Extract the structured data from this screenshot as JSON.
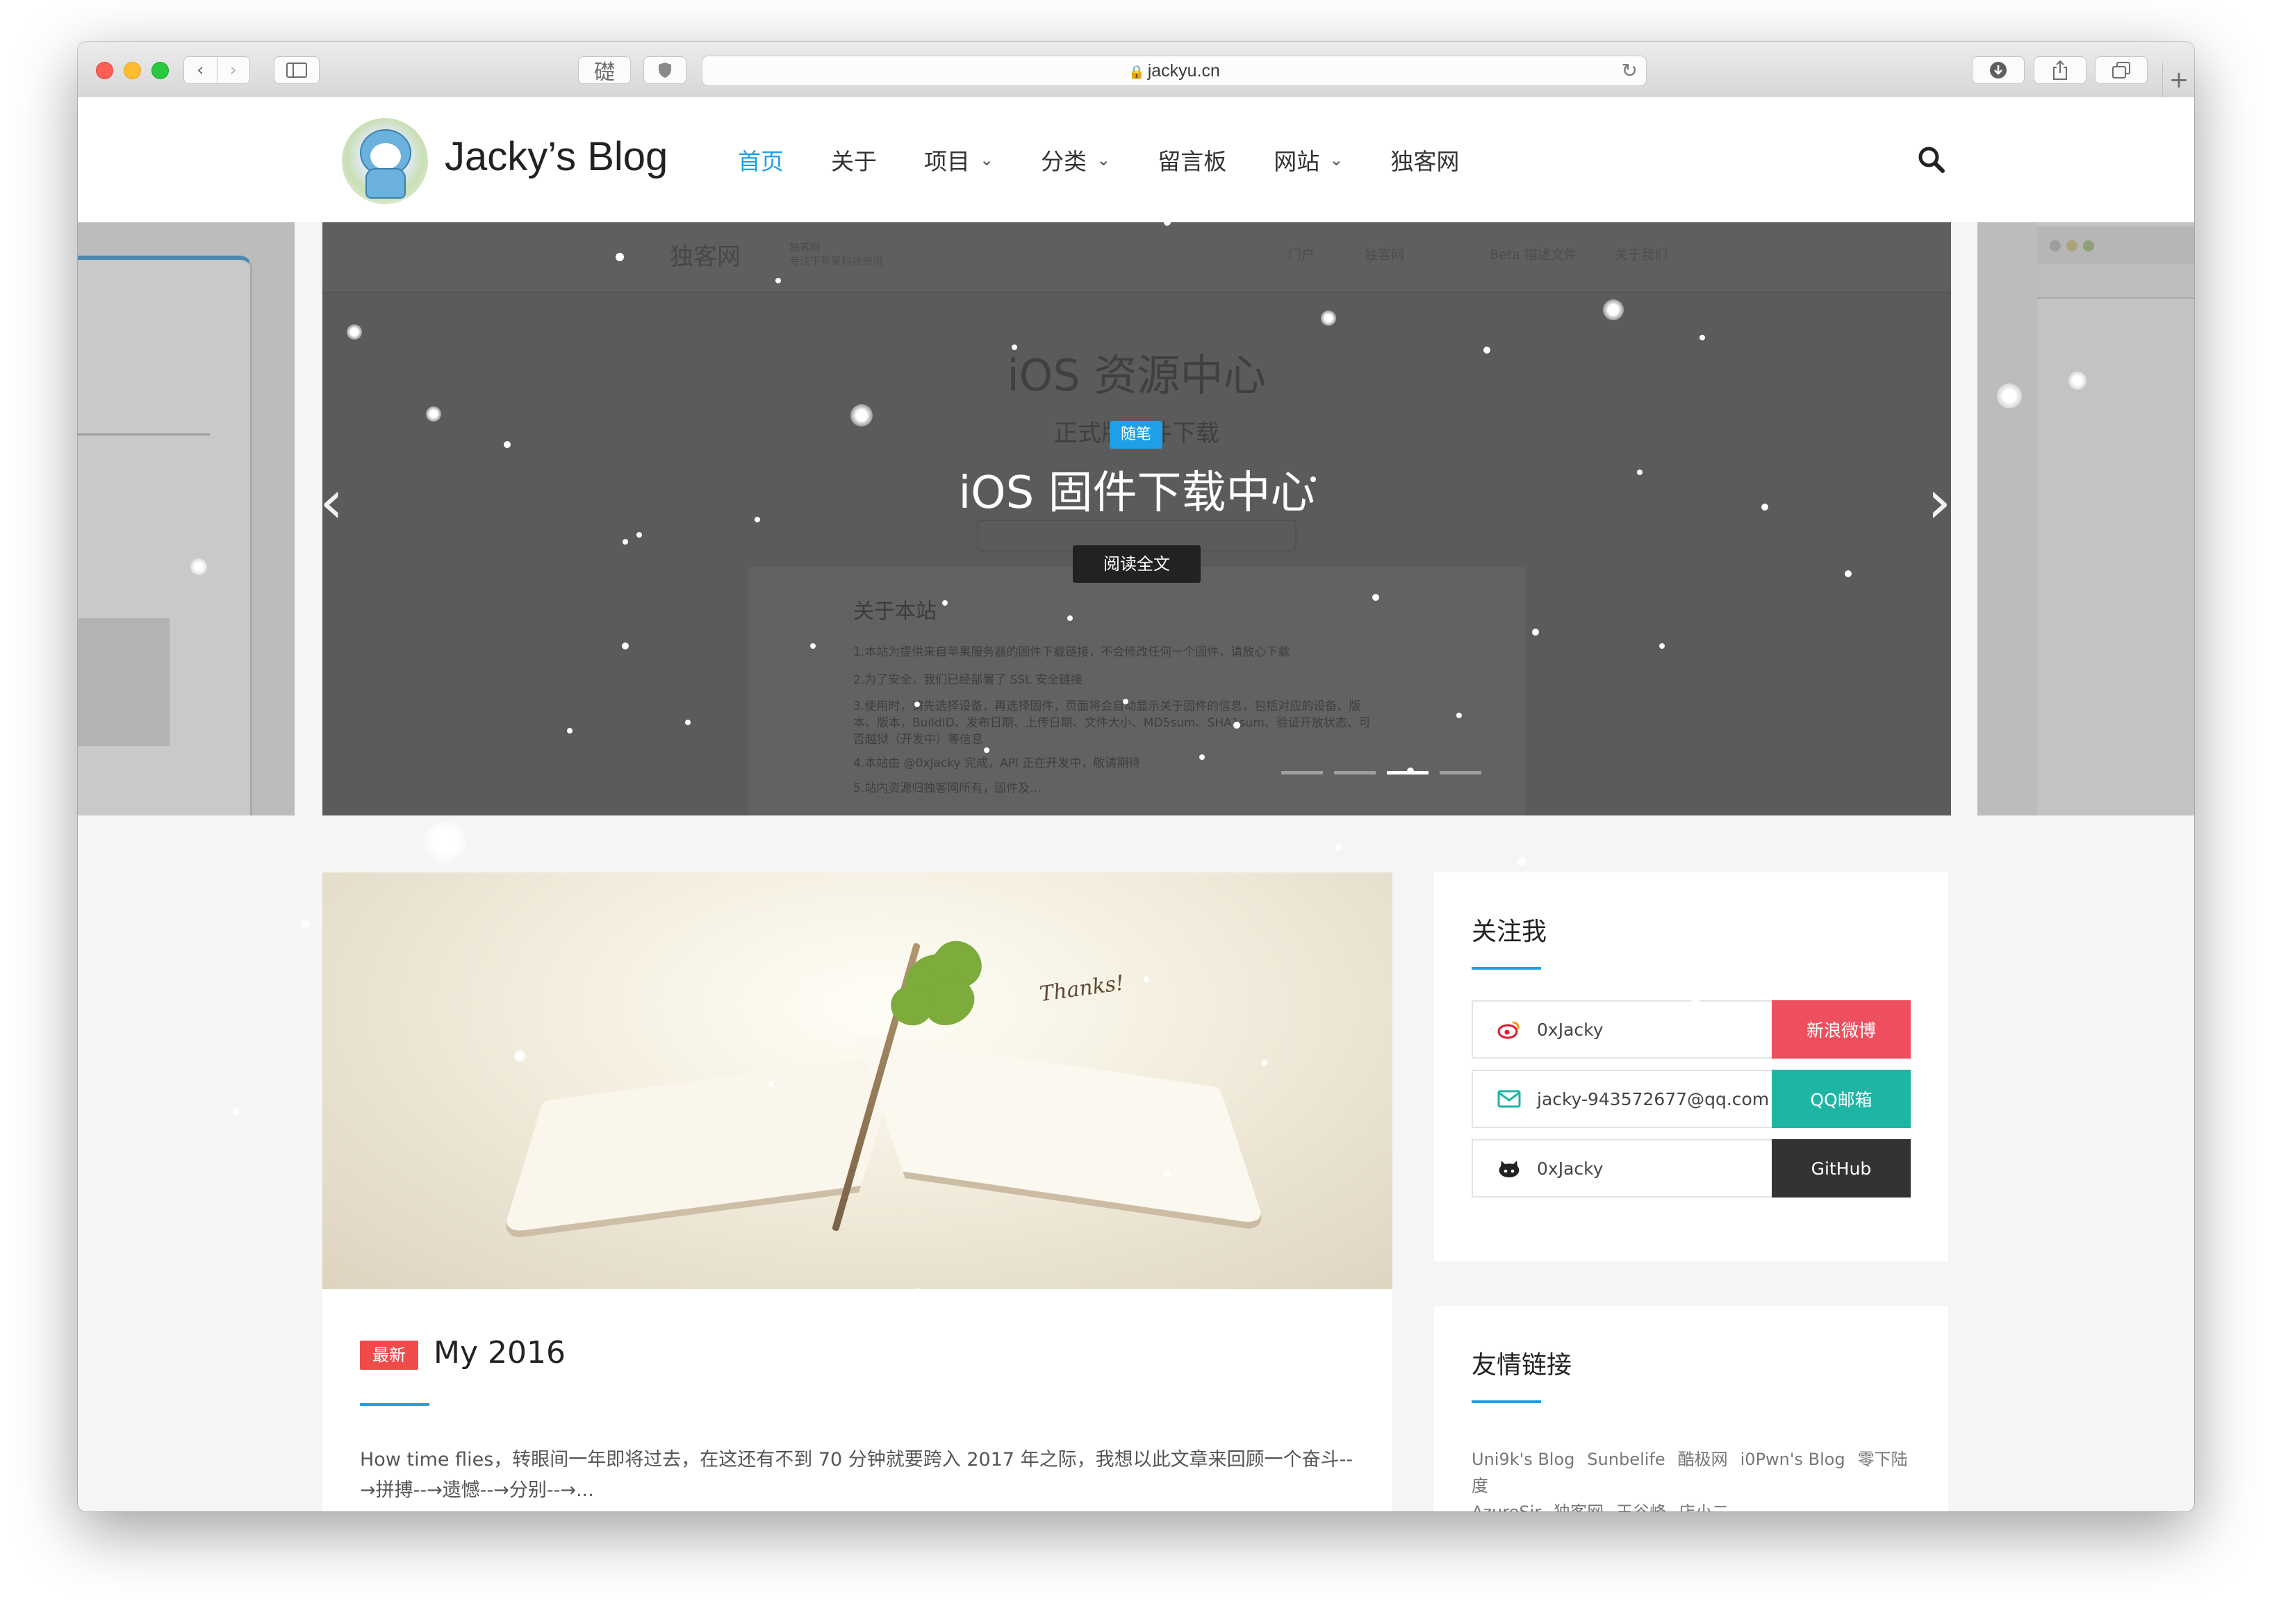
{
  "browser": {
    "url": "jackyu.cn",
    "reader_glyph": "礎"
  },
  "site": {
    "title": "Jacky’s Blog"
  },
  "nav": {
    "items": [
      {
        "label": "首页",
        "active": true,
        "dropdown": false
      },
      {
        "label": "关于",
        "active": false,
        "dropdown": false
      },
      {
        "label": "项目",
        "active": false,
        "dropdown": true
      },
      {
        "label": "分类",
        "active": false,
        "dropdown": true
      },
      {
        "label": "留言板",
        "active": false,
        "dropdown": false
      },
      {
        "label": "网站",
        "active": false,
        "dropdown": true
      },
      {
        "label": "独客网",
        "active": false,
        "dropdown": false
      }
    ]
  },
  "slider": {
    "background": {
      "logo": "独客网",
      "logo_sub_1": "独客网",
      "logo_sub_2": "专注于苹果科技资讯",
      "nav": [
        "门户",
        "独客网",
        "Beta 描述文件",
        "关于我们"
      ],
      "title": "iOS 资源中心",
      "subtitle": "正式版固件下载",
      "section_title": "关于本站",
      "lines": [
        "1.本站为提供来自苹果服务器的固件下载链接，不会修改任何一个固件，请放心下载",
        "2.为了安全，我们已经部署了 SSL 安全链接",
        "3.使用时，请先选择设备，再选择固件，页面将会自动显示关于固件的信息，包括对应的设备、版",
        "本、版本，BuildID、发布日期、上传日期、文件大小、MD5sum、SHA1sum、验证开放状态、可",
        "否越狱（开发中）等信息",
        "4.本站由 @0xJacky 完成，API 正在开发中，敬请期待",
        "5.站内资源归独客网所有，固件及..."
      ]
    },
    "category_tag": "随笔",
    "title": "iOS 固件下载中心",
    "read_more": "阅读全文",
    "active_dot": 3,
    "dot_count": 4
  },
  "post": {
    "badge": "最新",
    "title": "My 2016",
    "image_caption": "Thanks!",
    "excerpt": "How time flies，转眼间一年即将过去，在这还有不到 70 分钟就要跨入 2017 年之际，我想以此文章来回顾一个奋斗--→拼搏--→遗憾--→分别--→..."
  },
  "sidebar": {
    "follow_title": "关注我",
    "social": [
      {
        "icon": "weibo-icon",
        "value": "0xJacky",
        "button": "新浪微博",
        "color": "#ee4f5e"
      },
      {
        "icon": "mail-icon",
        "value": "jacky-943572677@qq.com",
        "button": "QQ邮箱",
        "color": "#1fb5a4"
      },
      {
        "icon": "github-icon",
        "value": "0xJacky",
        "button": "GitHub",
        "color": "#333333"
      }
    ],
    "links_title": "友情链接",
    "links": [
      "Uni9k's Blog",
      "Sunbelife",
      "酷极网",
      "i0Pwn's Blog",
      "零下陆度",
      "AzureSir",
      "独客网",
      "王谷峰",
      "店小二"
    ]
  },
  "colors": {
    "accent": "#1fa0e6",
    "badge_red": "#ef4b4b"
  }
}
